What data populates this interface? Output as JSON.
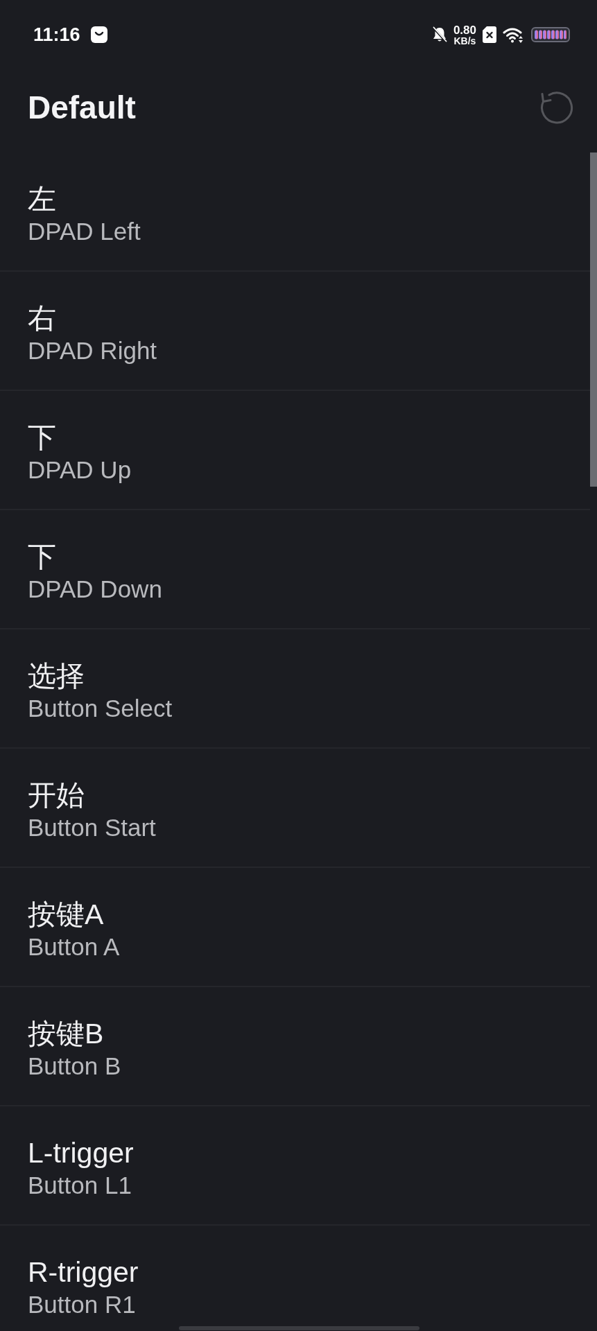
{
  "status_bar": {
    "time": "11:16",
    "net_speed": "0.80",
    "net_unit": "KB/s"
  },
  "header": {
    "title": "Default"
  },
  "bindings": [
    {
      "label": "左",
      "key": "DPAD Left"
    },
    {
      "label": "右",
      "key": "DPAD Right"
    },
    {
      "label": "下",
      "key": "DPAD Up"
    },
    {
      "label": "下",
      "key": "DPAD Down"
    },
    {
      "label": "选择",
      "key": "Button Select"
    },
    {
      "label": "开始",
      "key": "Button Start"
    },
    {
      "label": "按键A",
      "key": "Button A"
    },
    {
      "label": "按键B",
      "key": "Button B"
    },
    {
      "label": "L-trigger",
      "key": "Button L1"
    },
    {
      "label": "R-trigger",
      "key": "Button R1"
    }
  ]
}
